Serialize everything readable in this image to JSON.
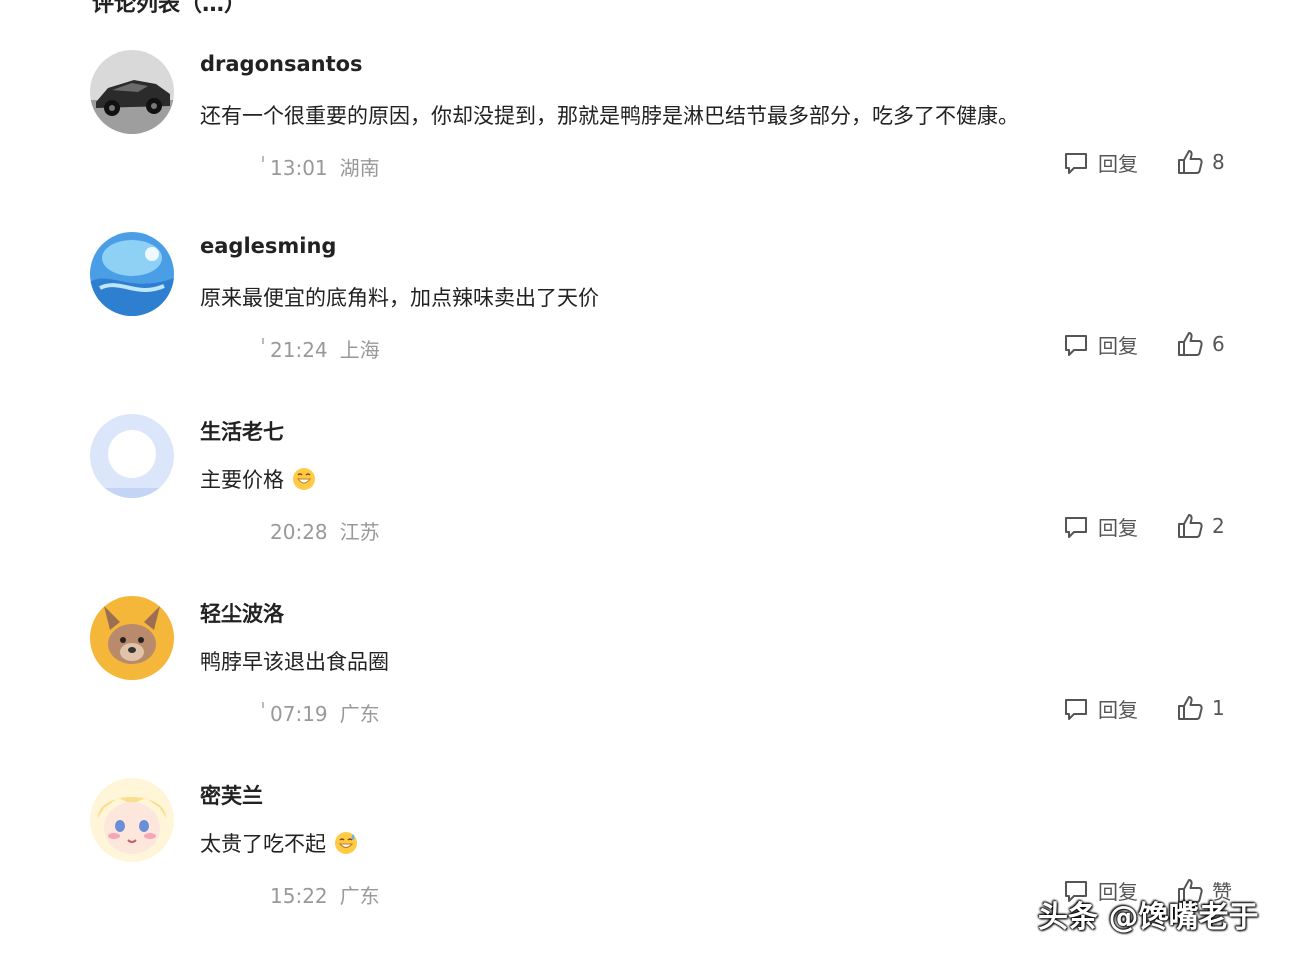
{
  "header": {
    "partial_title": "评论列表（…）"
  },
  "comments": [
    {
      "username": "dragonsantos",
      "text": "还有一个很重要的原因，你却没提到，那就是鸭脖是淋巴结节最多部分，吃多了不健康。",
      "time": "13:01",
      "location": "湖南",
      "reply_label": "回复",
      "likes": "8",
      "avatar_icon": "car-avatar"
    },
    {
      "username": "eaglesming",
      "text": "原来最便宜的底角料，加点辣味卖出了天价",
      "time": "21:24",
      "location": "上海",
      "reply_label": "回复",
      "likes": "6",
      "avatar_icon": "blue-swirl-avatar"
    },
    {
      "username": "生活老七",
      "text": "主要价格",
      "emoji": "grin-emoji",
      "time": "20:28",
      "location": "江苏",
      "reply_label": "回复",
      "likes": "2",
      "avatar_icon": "default-user-avatar"
    },
    {
      "username": "轻尘波洛",
      "text": "鸭脖早该退出食品圈",
      "time": "07:19",
      "location": "广东",
      "reply_label": "回复",
      "likes": "1",
      "avatar_icon": "dog-avatar"
    },
    {
      "username": "密芙兰",
      "text": "太贵了吃不起",
      "emoji": "sweat-smile-emoji",
      "time": "15:22",
      "location": "广东",
      "reply_label": "回复",
      "likes": "赞",
      "avatar_icon": "cartoon-girl-avatar"
    }
  ],
  "watermark": "头条 @馋嘴老于",
  "colors": {
    "text": "#222222",
    "meta": "#999999",
    "action": "#555555"
  }
}
